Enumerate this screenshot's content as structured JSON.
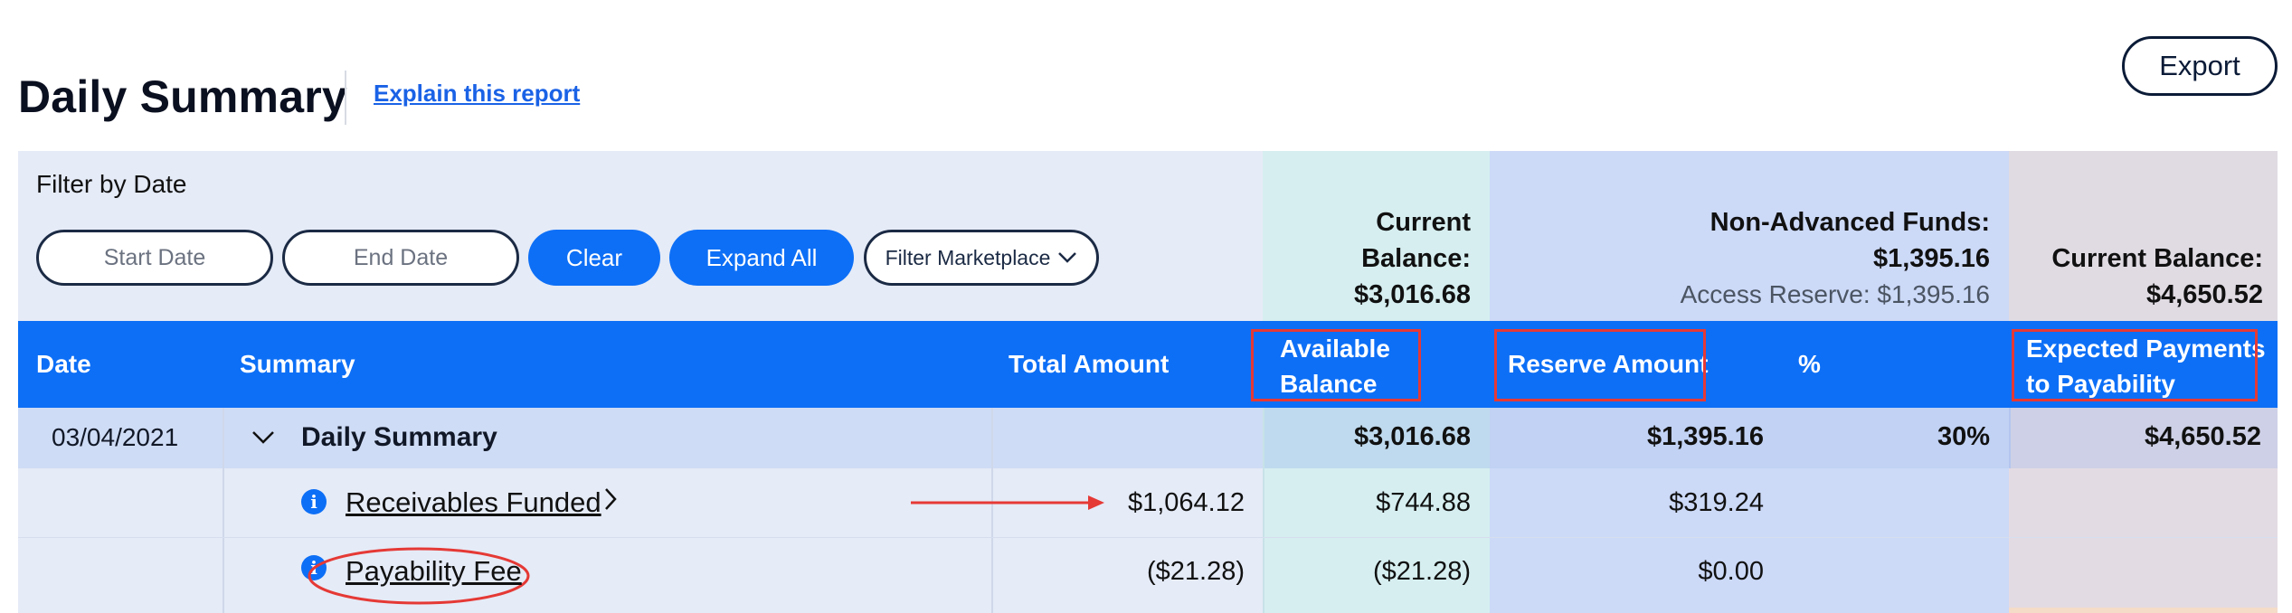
{
  "header": {
    "title": "Daily Summary",
    "explain_link": "Explain this report",
    "export_label": "Export"
  },
  "filter": {
    "label": "Filter by Date",
    "start_placeholder": "Start Date",
    "end_placeholder": "End Date",
    "clear_label": "Clear",
    "expand_label": "Expand All",
    "marketplace_label": "Filter Marketplace"
  },
  "balances": {
    "current_label_1": "Current",
    "current_label_2": "Balance:",
    "current_value": "$3,016.68",
    "non_advanced_label": "Non-Advanced Funds:",
    "non_advanced_value": "$1,395.16",
    "access_reserve": "Access Reserve: $1,395.16",
    "expected_label": "Current Balance:",
    "expected_value": "$4,650.52"
  },
  "table": {
    "columns": {
      "date": "Date",
      "summary": "Summary",
      "total": "Total Amount",
      "available_1": "Available",
      "available_2": "Balance",
      "reserve": "Reserve Amount",
      "percent": "%",
      "expected_1": "Expected Payments",
      "expected_2": "to Payability"
    },
    "summary_row": {
      "date": "03/04/2021",
      "label": "Daily Summary",
      "total": "",
      "available": "$3,016.68",
      "reserve": "$1,395.16",
      "percent": "30%",
      "expected": "$4,650.52"
    },
    "rows": [
      {
        "label": "Receivables Funded",
        "total": "$1,064.12",
        "available": "$744.88",
        "reserve": "$319.24"
      },
      {
        "label": "Payability Fee",
        "total": "($21.28)",
        "available": "($21.28)",
        "reserve": "$0.00"
      }
    ]
  },
  "annotation_color": "#e53935",
  "accent_color": "#0d6ff6"
}
